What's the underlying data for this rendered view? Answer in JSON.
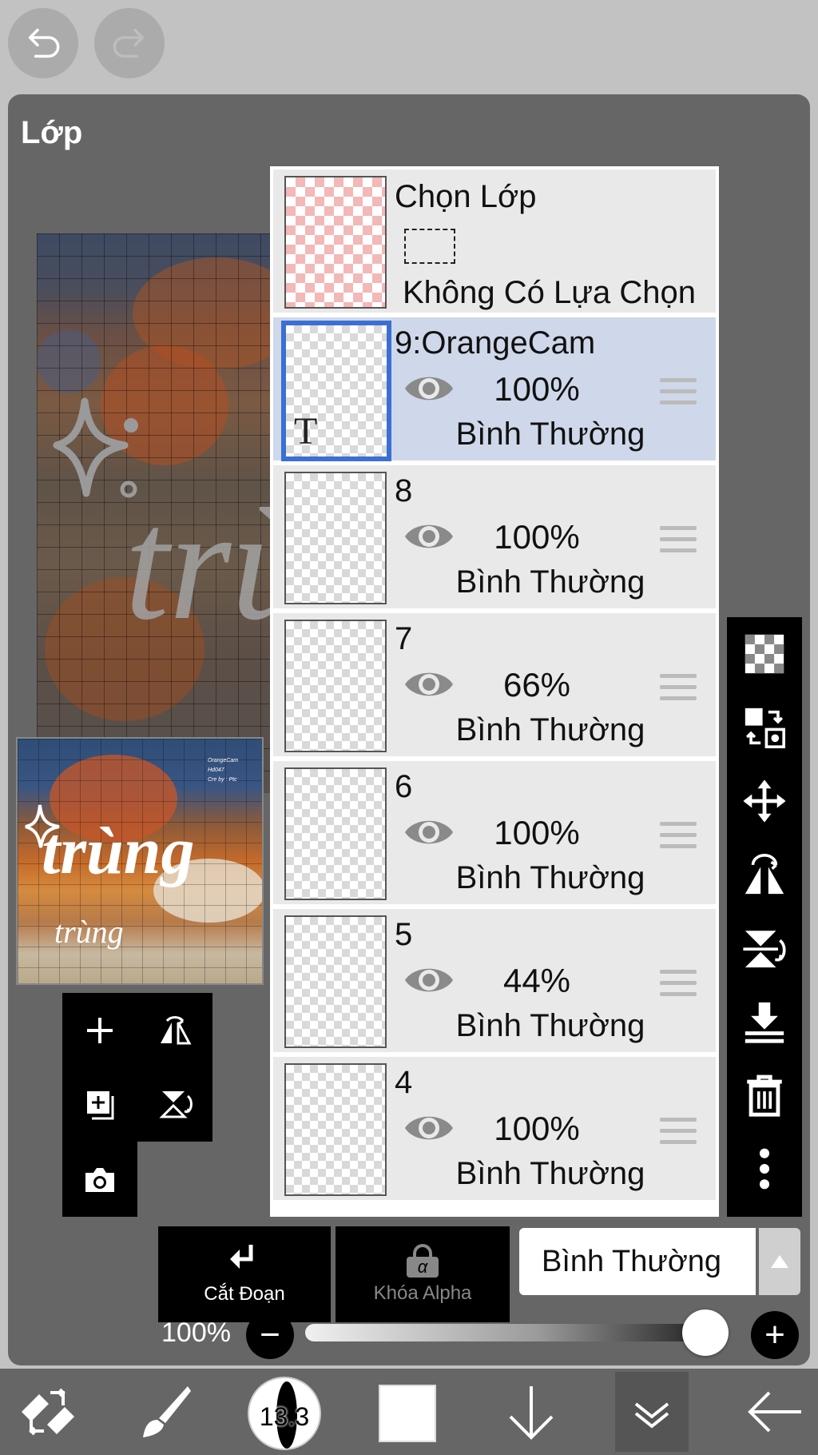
{
  "panel": {
    "title": "Lớp"
  },
  "selection_layer": {
    "title": "Chọn Lớp",
    "status": "Không Có Lựa Chọn"
  },
  "layers": [
    {
      "name": "9:OrangeCam",
      "opacity": "100%",
      "blend": "Bình Thường",
      "selected": true,
      "type": "text",
      "type_glyph": "T"
    },
    {
      "name": "8",
      "opacity": "100%",
      "blend": "Bình Thường",
      "selected": false
    },
    {
      "name": "7",
      "opacity": "66%",
      "blend": "Bình Thường",
      "selected": false
    },
    {
      "name": "6",
      "opacity": "100%",
      "blend": "Bình Thường",
      "selected": false
    },
    {
      "name": "5",
      "opacity": "44%",
      "blend": "Bình Thường",
      "selected": false
    },
    {
      "name": "4",
      "opacity": "100%",
      "blend": "Bình Thường",
      "selected": false
    }
  ],
  "bottom_controls": {
    "clip_label": "Cắt Đoạn",
    "alpha_lock_label": "Khóa Alpha",
    "alpha_lock_glyph": "α",
    "blend_mode": "Bình Thường",
    "opacity_label": "100%",
    "opacity_value": 1.0
  },
  "toolbar": {
    "brush_size": "13.3",
    "color": "#ffffff"
  },
  "canvas": {
    "preview_text": "trùng",
    "thumb_text_main": "trùng",
    "thumb_text_sub": "trùng",
    "thumb_caption": [
      "OrangeCam",
      "Hd047",
      "Cre by : Ptc"
    ]
  },
  "icons": {
    "undo": "undo-icon",
    "redo": "redo-icon",
    "left_tools": [
      "add-layer-icon",
      "flip-horizontal-icon",
      "add-copy-icon",
      "flip-vertical-icon",
      "camera-icon"
    ],
    "right_tools": [
      "transparent-icon",
      "swap-icon",
      "move-icon",
      "flip-h-icon",
      "flip-v-icon",
      "merge-down-icon",
      "trash-icon",
      "more-icon"
    ],
    "bottom": [
      "transform-icon",
      "brush-icon",
      "brush-size-icon",
      "color-icon",
      "down-arrow-icon",
      "layers-icon",
      "back-icon"
    ]
  }
}
